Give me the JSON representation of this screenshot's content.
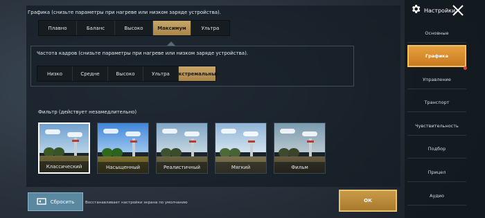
{
  "graphics_quality": {
    "label": "Графика (снизьте параметры при нагреве или низком заряде устройства).",
    "options": [
      "Плавно",
      "Баланс",
      "Высоко",
      "Максимум",
      "Ультра"
    ],
    "selected": "Максимум"
  },
  "frame_rate": {
    "label": "Частота кадров (снизьте параметры при нагреве или низком заряде устройства).",
    "options": [
      "Низко",
      "Средне",
      "Высоко",
      "Ультра",
      "Экстремальный"
    ],
    "selected": "Экстремальный"
  },
  "filter": {
    "label": "Фильтр (действует незамедлительно)",
    "options": [
      "Классический",
      "Насыщенный",
      "Реалистичный",
      "Мягкий",
      "Фильм"
    ],
    "selected": "Классический"
  },
  "footer": {
    "reset_label": "Сбросить",
    "reset_hint": "Восстанавливает настройки экрана по умолчанию",
    "ok_label": "ОК"
  },
  "sidebar": {
    "title": "Настройки",
    "items": [
      {
        "label": "Основные"
      },
      {
        "label": "Графика"
      },
      {
        "label": "Управление"
      },
      {
        "label": "Транспорт"
      },
      {
        "label": "Чувствительность"
      },
      {
        "label": "Подбор"
      },
      {
        "label": "Прицел"
      },
      {
        "label": "Аудио"
      }
    ],
    "active_item": "Графика"
  },
  "colors": {
    "accent_gold": "#c9a76a",
    "accent_orange": "#e6a040",
    "notification_red": "#e8402f"
  }
}
